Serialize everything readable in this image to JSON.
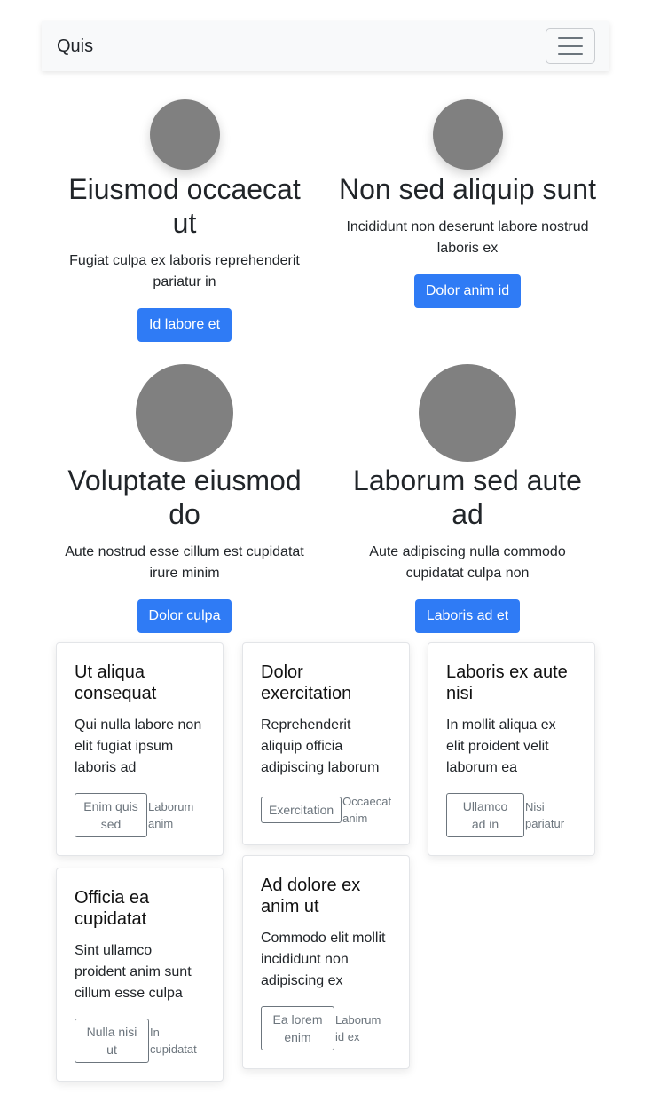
{
  "navbar": {
    "brand": "Quis",
    "toggler_icon": "hamburger-icon"
  },
  "features": [
    {
      "title": "Eiusmod occaecat ut",
      "text": "Fugiat culpa ex laboris reprehenderit pariatur in",
      "button": "Id labore et"
    },
    {
      "title": "Non sed aliquip sunt",
      "text": "Incididunt non deserunt labore nostrud laboris ex",
      "button": "Dolor anim id"
    },
    {
      "title": "Voluptate eiusmod do",
      "text": "Aute nostrud esse cillum est cupidatat irure minim",
      "button": "Dolor culpa"
    },
    {
      "title": "Laborum sed aute ad",
      "text": "Aute adipiscing nulla commodo cupidatat culpa non",
      "button": "Laboris ad et"
    }
  ],
  "cards": [
    {
      "title": "Ut aliqua consequat",
      "text": "Qui nulla labore non elit fugiat ipsum laboris ad",
      "button": "Enim quis sed",
      "note": "Laborum anim"
    },
    {
      "title": "Dolor exercitation",
      "text": "Reprehenderit aliquip officia adipiscing laborum",
      "button": "Exercitation",
      "note": "Occaecat anim"
    },
    {
      "title": "Laboris ex aute nisi",
      "text": "In mollit aliqua ex elit proident velit laborum ea",
      "button": "Ullamco ad in",
      "note": "Nisi pariatur"
    },
    {
      "title": "Officia ea cupidatat",
      "text": "Sint ullamco proident anim sunt cillum esse culpa",
      "button": "Nulla nisi ut",
      "note": "In cupidatat"
    },
    {
      "title": "Ad dolore ex anim ut",
      "text": "Commodo elit mollit incididunt non adipiscing ex",
      "button": "Ea lorem enim",
      "note": "Laborum id ex"
    }
  ],
  "colors": {
    "primary": "#2f7bf5",
    "avatar": "#808080",
    "navbar_bg": "#f8f9fa",
    "muted": "#6c757d"
  }
}
